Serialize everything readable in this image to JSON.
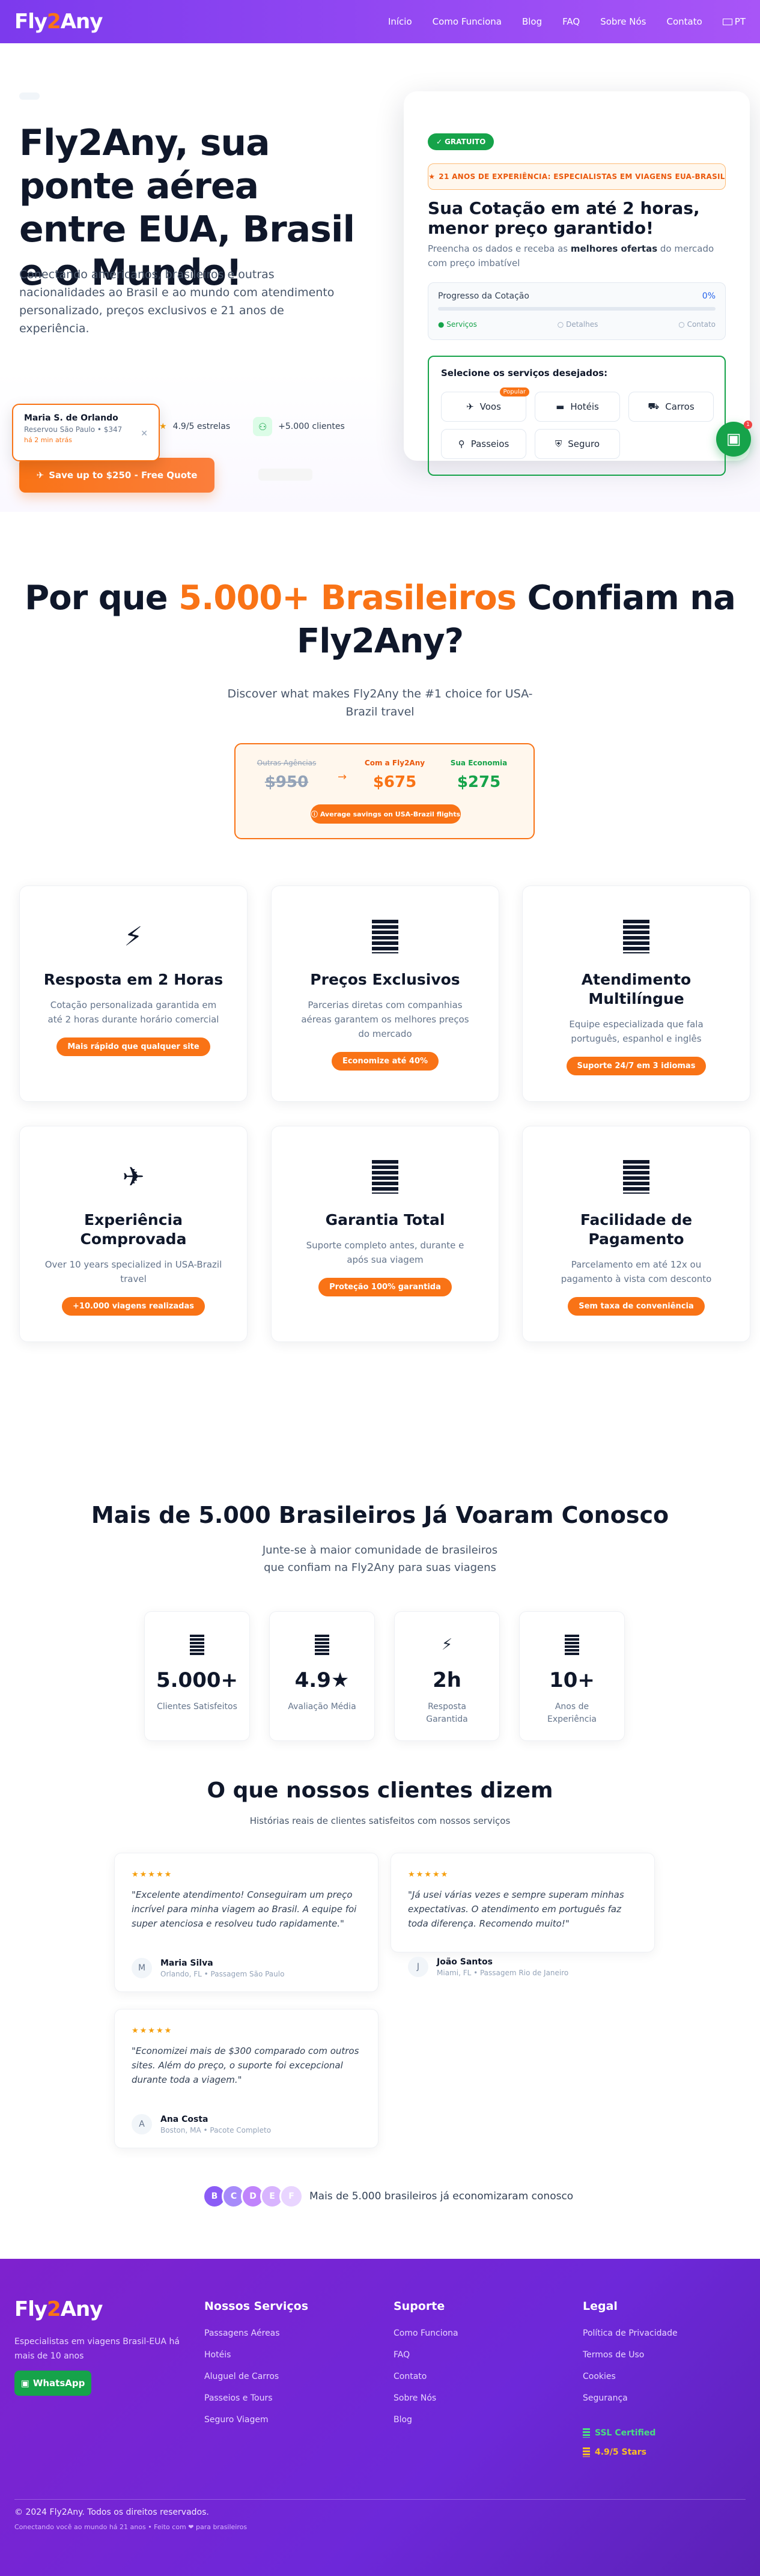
{
  "header": {
    "logo_left": "Fly",
    "logo_mid": "2",
    "logo_right": "Any",
    "nav": [
      "Início",
      "Como Funciona",
      "Blog",
      "FAQ",
      "Sobre Nós",
      "Contato"
    ],
    "lang": "PT"
  },
  "hero": {
    "title": "Fly2Any, sua ponte aérea entre EUA, Brasil e o Mundo!",
    "desc": "Conectando americanos, brasileiros e outras nacionalidades ao Brasil e ao mundo com atendimento personalizado, preços exclusivos e 21 anos de experiência.",
    "rating": "4.9/5 estrelas",
    "clients": "+5.000 clientes",
    "cta": "Save up to $250 - Free Quote",
    "toast": {
      "name": "Maria S. de Orlando",
      "text": "Reservou São Paulo • $347",
      "time": "há 2 min atrás"
    }
  },
  "quote": {
    "badge": "GRATUITO",
    "experience": "21 ANOS DE EXPERIÊNCIA: ESPECIALISTAS EM VIAGENS EUA-BRASIL",
    "title": "Sua Cotação em até 2 horas, menor preço garantido!",
    "sub_a": "Preencha os dados e receba as ",
    "sub_b": "melhores ofertas",
    "sub_c": " do mercado com preço imbatível",
    "progress_label": "Progresso da Cotação",
    "progress_pct": "0%",
    "progress_value": 0,
    "steps": [
      "Serviços",
      "Detalhes",
      "Contato"
    ],
    "services_title": "Selecione os serviços desejados:",
    "services": [
      "Voos",
      "Hotéis",
      "Carros",
      "Passeios",
      "Seguro"
    ],
    "popular": "Popular",
    "wa_count": "1"
  },
  "why": {
    "title_a": "Por que ",
    "title_b": "5.000+ Brasileiros",
    "title_c": " Confiam na Fly2Any?",
    "sub": "Discover what makes Fly2Any the #1 choice for USA-Brazil travel",
    "compare": {
      "others_label": "Outras Agências",
      "others_value": "$950",
      "fly_label": "Com a Fly2Any",
      "fly_value": "$675",
      "save_label": "Sua Economia",
      "save_value": "$275",
      "pill": "Average savings on USA-Brazil flights"
    },
    "features": [
      {
        "title": "Resposta em 2 Horas",
        "desc": "Cotação personalizada garantida em até 2 horas durante horário comercial",
        "pill": "Mais rápido que qualquer site"
      },
      {
        "title": "Preços Exclusivos",
        "desc": "Parcerias diretas com companhias aéreas garantem os melhores preços do mercado",
        "pill": "Economize até 40%"
      },
      {
        "title": "Atendimento Multilíngue",
        "desc": "Equipe especializada que fala português, espanhol e inglês",
        "pill": "Suporte 24/7 em 3 idiomas"
      },
      {
        "title": "Experiência Comprovada",
        "desc": "Over 10 years specialized in USA-Brazil travel",
        "pill": "+10.000 viagens realizadas"
      },
      {
        "title": "Garantia Total",
        "desc": "Suporte completo antes, durante e após sua viagem",
        "pill": "Proteção 100% garantida"
      },
      {
        "title": "Facilidade de Pagamento",
        "desc": "Parcelamento em até 12x ou pagamento à vista com desconto",
        "pill": "Sem taxa de conveniência"
      }
    ]
  },
  "social": {
    "title": "Mais de 5.000 Brasileiros Já Voaram Conosco",
    "sub": "Junte-se à maior comunidade de brasileiros que confiam na Fly2Any para suas viagens",
    "stats": [
      {
        "value": "5.000+",
        "label": "Clientes Satisfeitos"
      },
      {
        "value": "4.9★",
        "label": "Avaliação Média"
      },
      {
        "value": "2h",
        "label": "Resposta Garantida"
      },
      {
        "value": "10+",
        "label": "Anos de Experiência"
      }
    ],
    "testi_title": "O que nossos clientes dizem",
    "testi_sub": "Histórias reais de clientes satisfeitos com nossos serviços",
    "stars": "★★★★★",
    "testimonials": [
      {
        "quote": "\"Excelente atendimento! Conseguiram um preço incrível para minha viagem ao Brasil. A equipe foi super atenciosa e resolveu tudo rapidamente.\"",
        "initial": "M",
        "name": "Maria Silva",
        "loc": "Orlando, FL • Passagem São Paulo"
      },
      {
        "quote": "\"Já usei várias vezes e sempre superam minhas expectativas. O atendimento em português faz toda diferença. Recomendo muito!\"",
        "initial": "J",
        "name": "João Santos",
        "loc": "Miami, FL • Passagem Rio de Janeiro"
      },
      {
        "quote": "\"Economizei mais de $300 comparado com outros sites. Além do preço, o suporte foi excepcional durante toda a viagem.\"",
        "initial": "A",
        "name": "Ana Costa",
        "loc": "Boston, MA • Pacote Completo"
      }
    ],
    "avatars": [
      "B",
      "C",
      "D",
      "E",
      "F"
    ],
    "avatar_colors": [
      "#8b5cf6",
      "#a78bfa",
      "#c084fc",
      "#d8b4fe",
      "#e9d5ff"
    ],
    "savers": "Mais de 5.000 brasileiros já economizaram conosco"
  },
  "footer": {
    "desc": "Especialistas em viagens Brasil-EUA há mais de 10 anos",
    "wa": "WhatsApp",
    "cols": [
      {
        "title": "Nossos Serviços",
        "links": [
          "Passagens Aéreas",
          "Hotéis",
          "Aluguel de Carros",
          "Passeios e Tours",
          "Seguro Viagem"
        ]
      },
      {
        "title": "Suporte",
        "links": [
          "Como Funciona",
          "FAQ",
          "Contato",
          "Sobre Nós",
          "Blog"
        ]
      },
      {
        "title": "Legal",
        "links": [
          "Política de Privacidade",
          "Termos de Uso",
          "Cookies",
          "Segurança"
        ]
      }
    ],
    "badges": [
      "SSL Certified",
      "4.9/5 Stars"
    ],
    "badge_colors": [
      "#4ade80",
      "#fbbf24"
    ],
    "copyright": "© 2024 Fly2Any. Todos os direitos reservados.",
    "tagline": "Conectando você ao mundo há 21 anos • Feito com ❤ para brasileiros"
  }
}
